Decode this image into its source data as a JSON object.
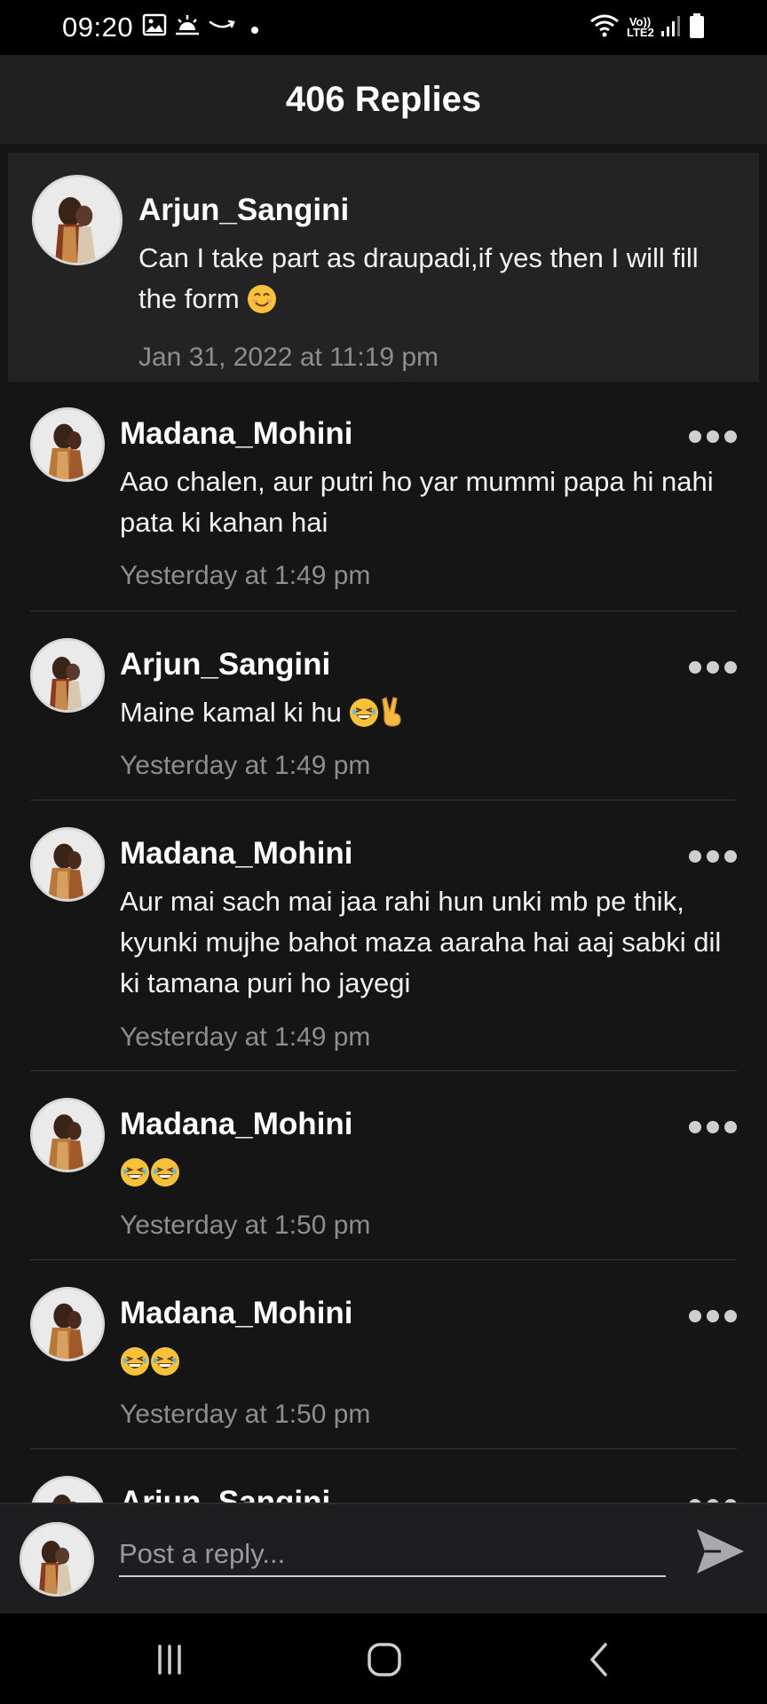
{
  "status_bar": {
    "time": "09:20",
    "network_label": "Vo)) LTE2",
    "icons": [
      "image-icon",
      "sunrise-icon",
      "amazon-smile-icon",
      "dot-icon",
      "wifi-icon",
      "signal-icon",
      "battery-icon"
    ]
  },
  "header": {
    "title": "406 Replies"
  },
  "parent_post": {
    "author": "Arjun_Sangini",
    "text": "Can I take part as draupadi,if yes then I will fill the form",
    "emoji": "smiling-face-icon",
    "timestamp": "Jan 31, 2022 at 11:19 pm"
  },
  "replies": [
    {
      "author": "Madana_Mohini",
      "text": "Aao chalen, aur putri ho yar mummi papa hi nahi pata ki kahan hai",
      "emoji": "",
      "timestamp": "Yesterday at 1:49 pm"
    },
    {
      "author": "Arjun_Sangini",
      "text": "Maine kamal ki hu",
      "emoji": "laughing-face-icon victory-hand-icon",
      "timestamp": "Yesterday at 1:49 pm"
    },
    {
      "author": "Madana_Mohini",
      "text": "Aur mai sach mai jaa rahi hun unki mb pe thik, kyunki mujhe bahot maza aaraha hai aaj sabki dil ki tamana puri ho jayegi",
      "emoji": "",
      "timestamp": "Yesterday at 1:49 pm"
    },
    {
      "author": "Madana_Mohini",
      "text": "",
      "emoji": "laughing-face-icon laughing-face-icon",
      "timestamp": "Yesterday at 1:50 pm"
    },
    {
      "author": "Madana_Mohini",
      "text": "",
      "emoji": "laughing-face-icon laughing-face-icon",
      "timestamp": "Yesterday at 1:50 pm"
    },
    {
      "author": "Arjun_Sangini",
      "text": "",
      "emoji": "",
      "timestamp": ""
    }
  ],
  "composer": {
    "placeholder": "Post a reply..."
  },
  "colors": {
    "background": "#151516",
    "header": "#202021",
    "parent_post": "#232324",
    "timestamp": "#8e8e90",
    "bar": "#000000"
  }
}
